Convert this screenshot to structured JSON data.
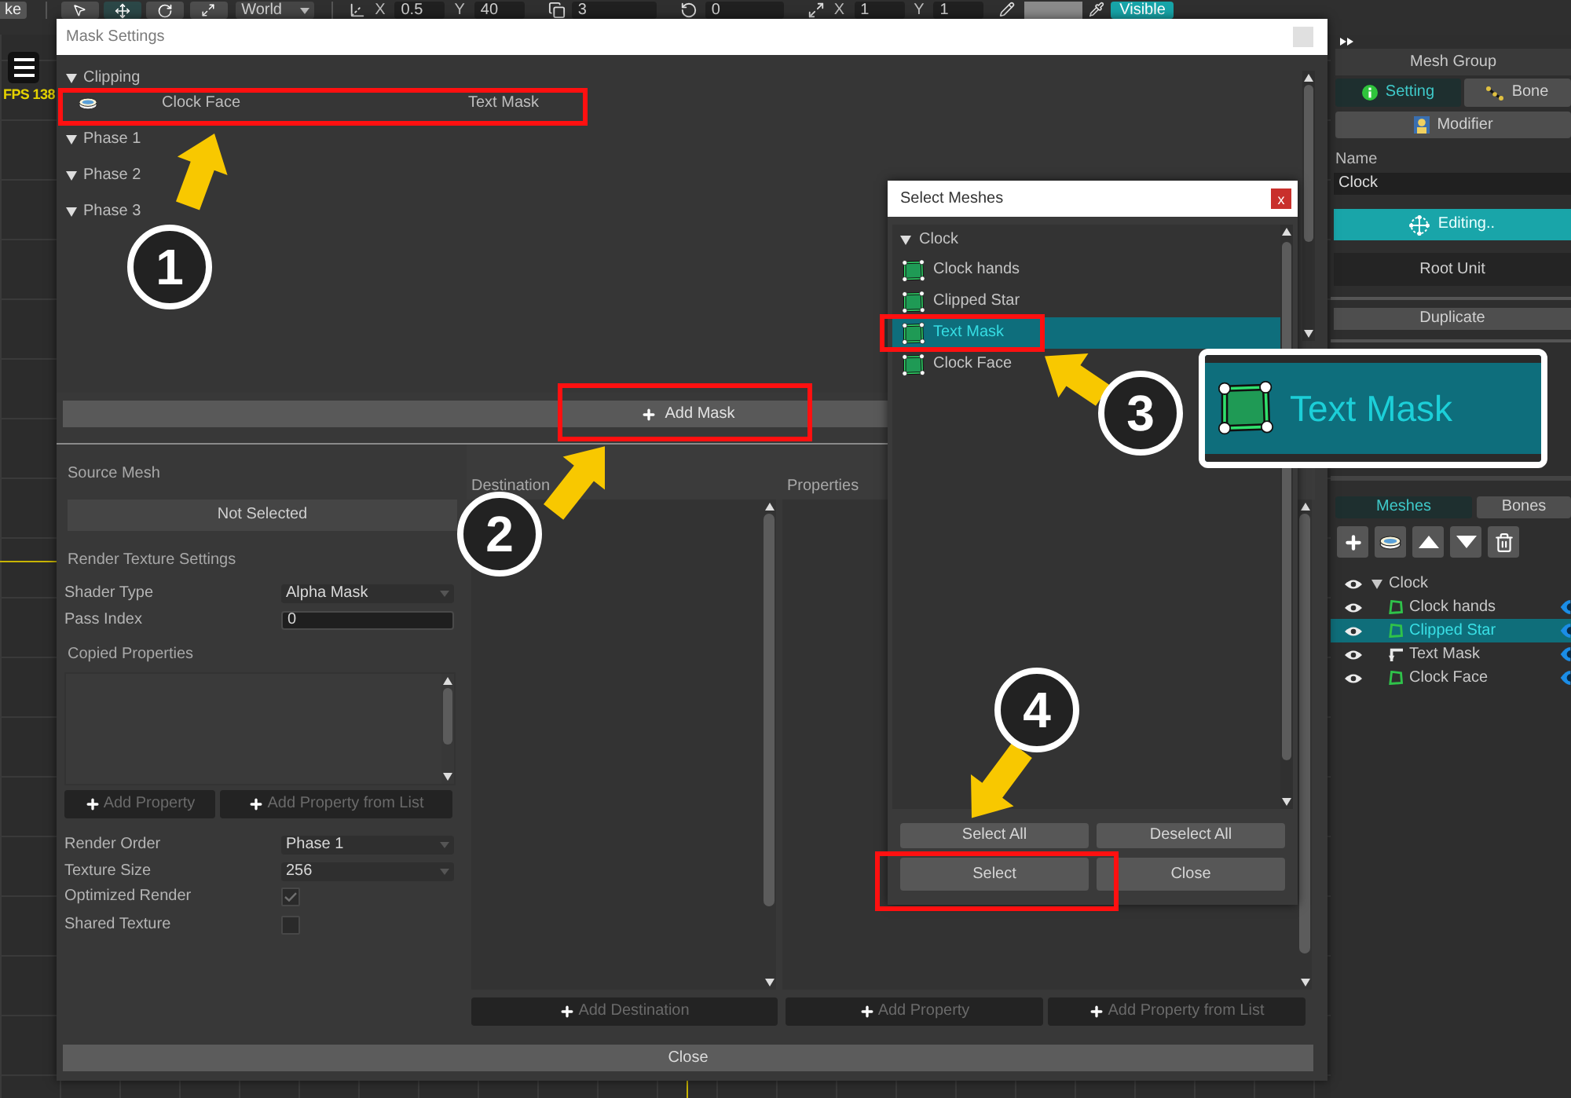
{
  "toolbar": {
    "mode_button": "ke",
    "space": "World",
    "position": [
      {
        "axis": "X",
        "value": "0.5"
      },
      {
        "axis": "Y",
        "value": "40"
      }
    ],
    "depth": "3",
    "rotation": "0",
    "scale": [
      {
        "axis": "X",
        "value": "1"
      },
      {
        "axis": "Y",
        "value": "1"
      }
    ],
    "visibility": "Visible"
  },
  "hud": {
    "fps": "FPS 138"
  },
  "mask_settings": {
    "title": "Mask Settings",
    "groups": [
      {
        "label": "Clipping",
        "expanded": true,
        "masks": [
          {
            "source": "Clock Face",
            "destination": "Text Mask"
          }
        ]
      },
      {
        "label": "Phase 1",
        "expanded": true
      },
      {
        "label": "Phase 2",
        "expanded": true
      },
      {
        "label": "Phase 3",
        "expanded": true
      }
    ],
    "add_mask": "Add Mask",
    "source": {
      "header": "Source Mesh",
      "mesh": "Not Selected",
      "render_title": "Render Texture Settings",
      "render_fields": [
        {
          "kind": "dropdown",
          "label": "Shader Type",
          "value": "Alpha Mask"
        },
        {
          "kind": "input",
          "label": "Pass Index",
          "value": "0"
        }
      ],
      "copied_title": "Copied Properties",
      "buttons": [
        "Add Property",
        "Add Property from List"
      ],
      "options": [
        {
          "kind": "dropdown",
          "label": "Render Order",
          "value": "Phase 1"
        },
        {
          "kind": "dropdown",
          "label": "Texture Size",
          "value": "256"
        },
        {
          "kind": "checkbox",
          "label": "Optimized Render",
          "checked": true
        },
        {
          "kind": "checkbox",
          "label": "Shared Texture",
          "checked": false
        }
      ]
    },
    "destination": {
      "header": "Destination",
      "buttons": [
        "Add Destination"
      ]
    },
    "properties": {
      "header": "Properties",
      "buttons": [
        "Add Property",
        "Add Property from List"
      ]
    },
    "close": "Close"
  },
  "select_meshes": {
    "title": "Select Meshes",
    "close": "x",
    "group": {
      "label": "Clock",
      "expanded": true
    },
    "items": [
      {
        "label": "Clock hands",
        "selected": false
      },
      {
        "label": "Clipped Star",
        "selected": false
      },
      {
        "label": "Text Mask",
        "selected": true
      },
      {
        "label": "Clock Face",
        "selected": false
      }
    ],
    "buttons": [
      "Select All",
      "Deselect All",
      "Select",
      "Close"
    ]
  },
  "side_panel": {
    "title": "Mesh Group",
    "tabs": [
      {
        "label": "Setting",
        "selected": true
      },
      {
        "label": "Bone",
        "selected": false
      }
    ],
    "modifier": "Modifier",
    "name_label": "Name",
    "name_value": "Clock",
    "editing": "Editing..",
    "root_unit": "Root Unit",
    "duplicate": "Duplicate",
    "list_tabs": [
      {
        "label": "Meshes",
        "selected": true
      },
      {
        "label": "Bones",
        "selected": false
      }
    ],
    "tree": {
      "label": "Clock",
      "expanded": true,
      "children": [
        {
          "label": "Clock hands",
          "kind": "mesh",
          "selected": false
        },
        {
          "label": "Clipped Star",
          "kind": "mesh",
          "selected": true
        },
        {
          "label": "Text Mask",
          "kind": "clipped",
          "selected": false
        },
        {
          "label": "Clock Face",
          "kind": "mesh",
          "selected": false
        }
      ]
    }
  },
  "annotations": {
    "steps": [
      "1",
      "2",
      "3",
      "4"
    ],
    "inset": {
      "label": "Text Mask"
    }
  }
}
